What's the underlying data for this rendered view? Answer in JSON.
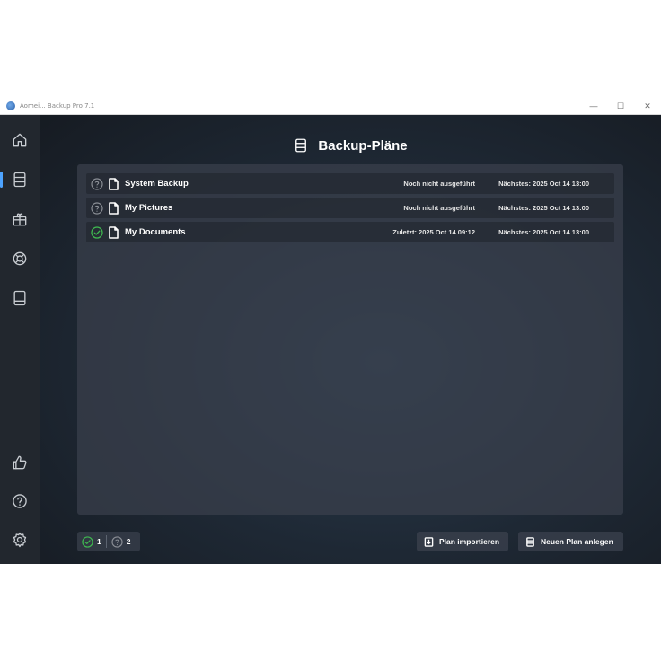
{
  "window": {
    "title": "Aomei... Backup Pro 7.1",
    "controls": {
      "minimize": "—",
      "maximize": "☐",
      "close": "✕"
    }
  },
  "sidebar": {
    "items": [
      {
        "name": "home",
        "icon": "home-icon"
      },
      {
        "name": "backup-plans",
        "icon": "list-icon",
        "active": true
      },
      {
        "name": "gift",
        "icon": "gift-icon"
      },
      {
        "name": "support",
        "icon": "lifebuoy-icon"
      },
      {
        "name": "book",
        "icon": "book-icon"
      },
      {
        "name": "feedback",
        "icon": "thumbs-up-icon"
      },
      {
        "name": "help",
        "icon": "help-icon"
      },
      {
        "name": "settings",
        "icon": "gear-icon"
      }
    ]
  },
  "header": {
    "title": "Backup-Pläne"
  },
  "plans": [
    {
      "name": "System Backup",
      "status": "unknown",
      "last": "Noch nicht ausgeführt",
      "next": "Nächstes: 2025 Oct 14 13:00"
    },
    {
      "name": "My Pictures",
      "status": "unknown",
      "last": "Noch nicht ausgeführt",
      "next": "Nächstes: 2025 Oct 14 13:00"
    },
    {
      "name": "My Documents",
      "status": "success",
      "last": "Zuletzt: 2025 Oct 14 09:12",
      "next": "Nächstes: 2025 Oct 14 13:00"
    }
  ],
  "footer": {
    "success_count": "1",
    "unknown_count": "2",
    "import_label": "Plan importieren",
    "new_plan_label": "Neuen Plan anlegen"
  },
  "colors": {
    "accent": "#4da3ff",
    "success": "#3fb950",
    "unknown": "#8b8f96"
  }
}
